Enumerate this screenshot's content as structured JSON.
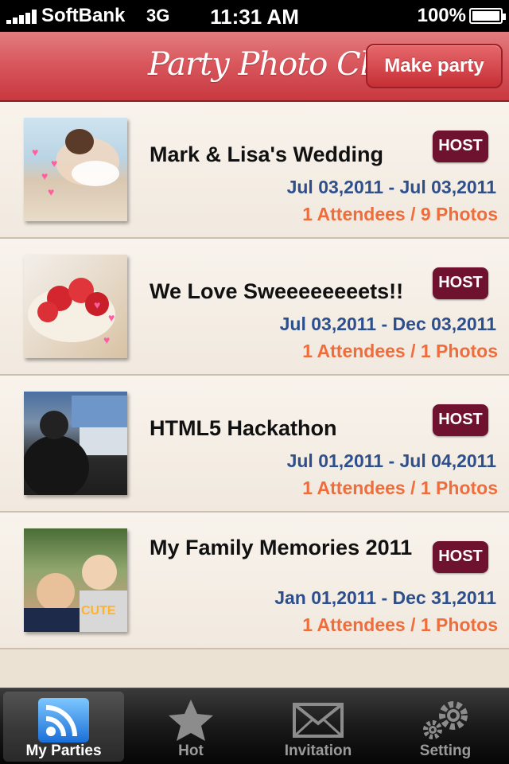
{
  "status_bar": {
    "carrier": "SoftBank",
    "network": "3G",
    "time": "11:31 AM",
    "battery": "100%"
  },
  "header": {
    "title": "Party Photo Clip",
    "make_party_label": "Make party"
  },
  "parties": [
    {
      "title": "Mark & Lisa's Wedding",
      "badge": "HOST",
      "dates": "Jul 03,2011 - Jul 03,2011",
      "stats": "1 Attendees / 9 Photos"
    },
    {
      "title": "We Love Sweeeeeeeets!!",
      "badge": "HOST",
      "dates": "Jul 03,2011 - Dec 03,2011",
      "stats": "1 Attendees / 1 Photos"
    },
    {
      "title": "HTML5 Hackathon",
      "badge": "HOST",
      "dates": "Jul 01,2011 - Jul 04,2011",
      "stats": "1 Attendees / 1 Photos"
    },
    {
      "title": "My Family Memories 2011",
      "badge": "HOST",
      "dates": "Jan 01,2011 - Dec 31,2011",
      "stats": "1 Attendees / 1 Photos",
      "thumb_caption": "CUTE"
    }
  ],
  "tabs": [
    {
      "label": "My Parties",
      "icon": "rss-icon",
      "active": true
    },
    {
      "label": "Hot",
      "icon": "star-icon",
      "active": false
    },
    {
      "label": "Invitation",
      "icon": "envelope-icon",
      "active": false
    },
    {
      "label": "Setting",
      "icon": "gears-icon",
      "active": false
    }
  ],
  "colors": {
    "header_red": "#d9585e",
    "host_badge": "#6e1230",
    "dates_blue": "#2d4f8c",
    "stats_orange": "#f06c3a"
  }
}
